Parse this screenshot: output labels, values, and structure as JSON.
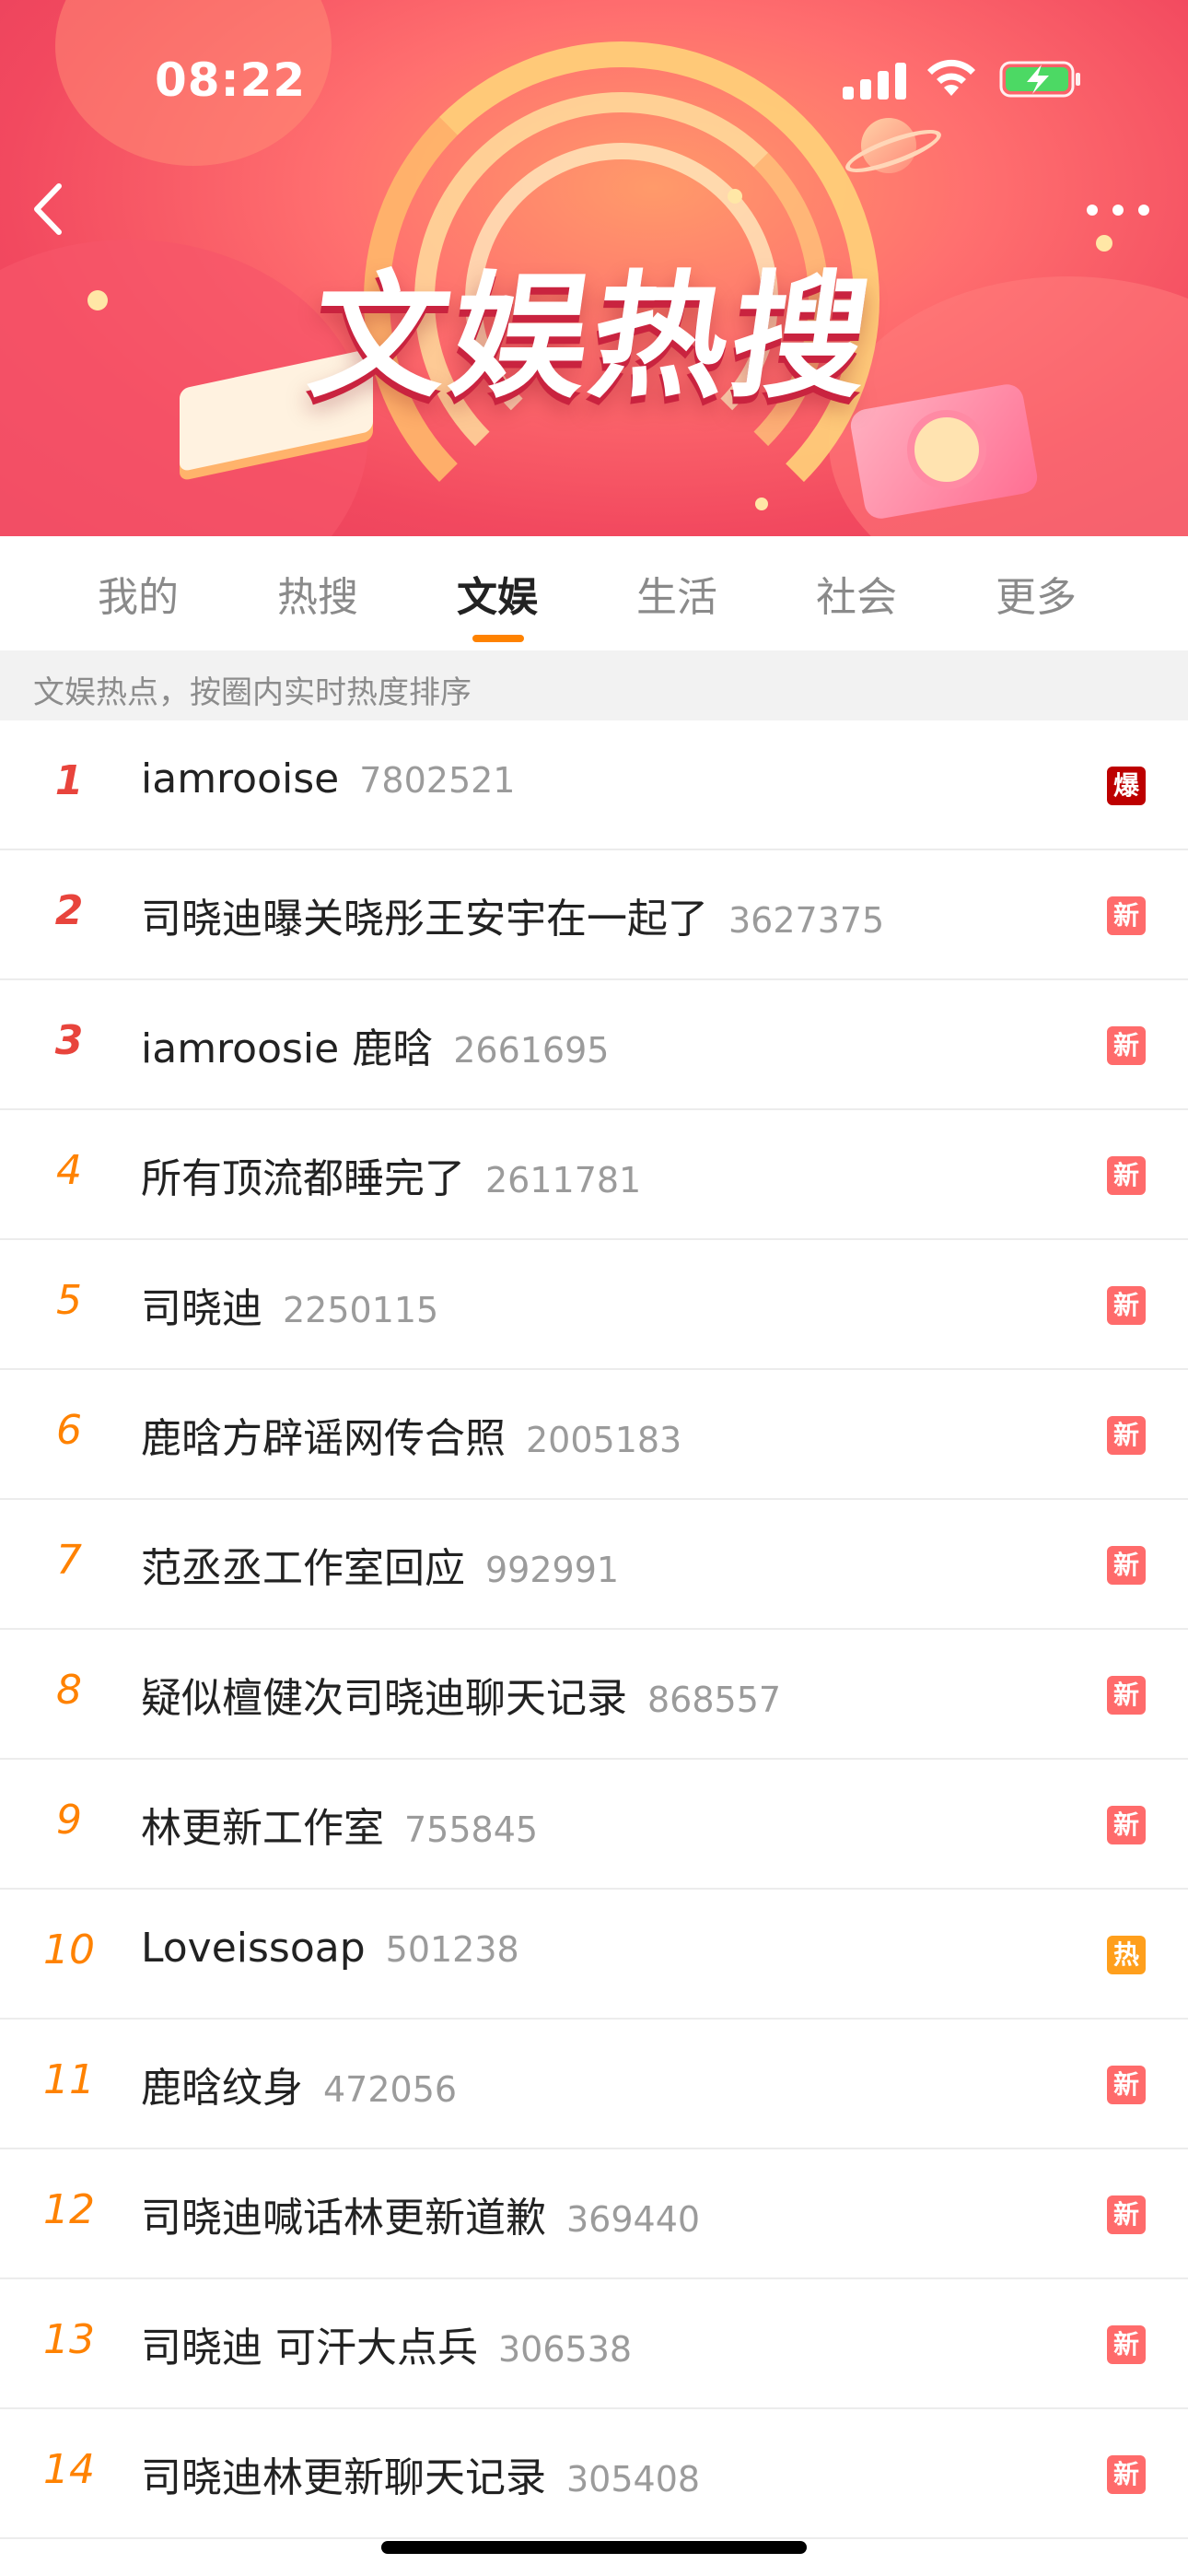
{
  "status_bar": {
    "time": "08:22"
  },
  "banner": {
    "title": "文娱热搜"
  },
  "tabs": [
    {
      "label": "我的",
      "active": false
    },
    {
      "label": "热搜",
      "active": false
    },
    {
      "label": "文娱",
      "active": true
    },
    {
      "label": "生活",
      "active": false
    },
    {
      "label": "社会",
      "active": false
    },
    {
      "label": "更多",
      "active": false
    }
  ],
  "subheader": "文娱热点，按圈内实时热度排序",
  "colors": {
    "accent": "#ff8200",
    "rank_top": "#e8443c",
    "badge_new": "#ff6b6b",
    "badge_hot": "#ff9f1c",
    "badge_boom": "#bd0000"
  },
  "items": [
    {
      "rank": "1",
      "title": "iamrooise",
      "count": "7802521",
      "badge": "爆",
      "badge_type": "boom"
    },
    {
      "rank": "2",
      "title": "司晓迪曝关晓彤王安宇在一起了",
      "count": "3627375",
      "badge": "新",
      "badge_type": "new"
    },
    {
      "rank": "3",
      "title": "iamroosie 鹿晗",
      "count": "2661695",
      "badge": "新",
      "badge_type": "new"
    },
    {
      "rank": "4",
      "title": "所有顶流都睡完了",
      "count": "2611781",
      "badge": "新",
      "badge_type": "new"
    },
    {
      "rank": "5",
      "title": "司晓迪",
      "count": "2250115",
      "badge": "新",
      "badge_type": "new"
    },
    {
      "rank": "6",
      "title": "鹿晗方辟谣网传合照",
      "count": "2005183",
      "badge": "新",
      "badge_type": "new"
    },
    {
      "rank": "7",
      "title": "范丞丞工作室回应",
      "count": "992991",
      "badge": "新",
      "badge_type": "new"
    },
    {
      "rank": "8",
      "title": "疑似檀健次司晓迪聊天记录",
      "count": "868557",
      "badge": "新",
      "badge_type": "new"
    },
    {
      "rank": "9",
      "title": "林更新工作室",
      "count": "755845",
      "badge": "新",
      "badge_type": "new"
    },
    {
      "rank": "10",
      "title": "Loveissoap",
      "count": "501238",
      "badge": "热",
      "badge_type": "hot"
    },
    {
      "rank": "11",
      "title": "鹿晗纹身",
      "count": "472056",
      "badge": "新",
      "badge_type": "new"
    },
    {
      "rank": "12",
      "title": "司晓迪喊话林更新道歉",
      "count": "369440",
      "badge": "新",
      "badge_type": "new"
    },
    {
      "rank": "13",
      "title": "司晓迪 可汗大点兵",
      "count": "306538",
      "badge": "新",
      "badge_type": "new"
    },
    {
      "rank": "14",
      "title": "司晓迪林更新聊天记录",
      "count": "305408",
      "badge": "新",
      "badge_type": "new"
    }
  ]
}
